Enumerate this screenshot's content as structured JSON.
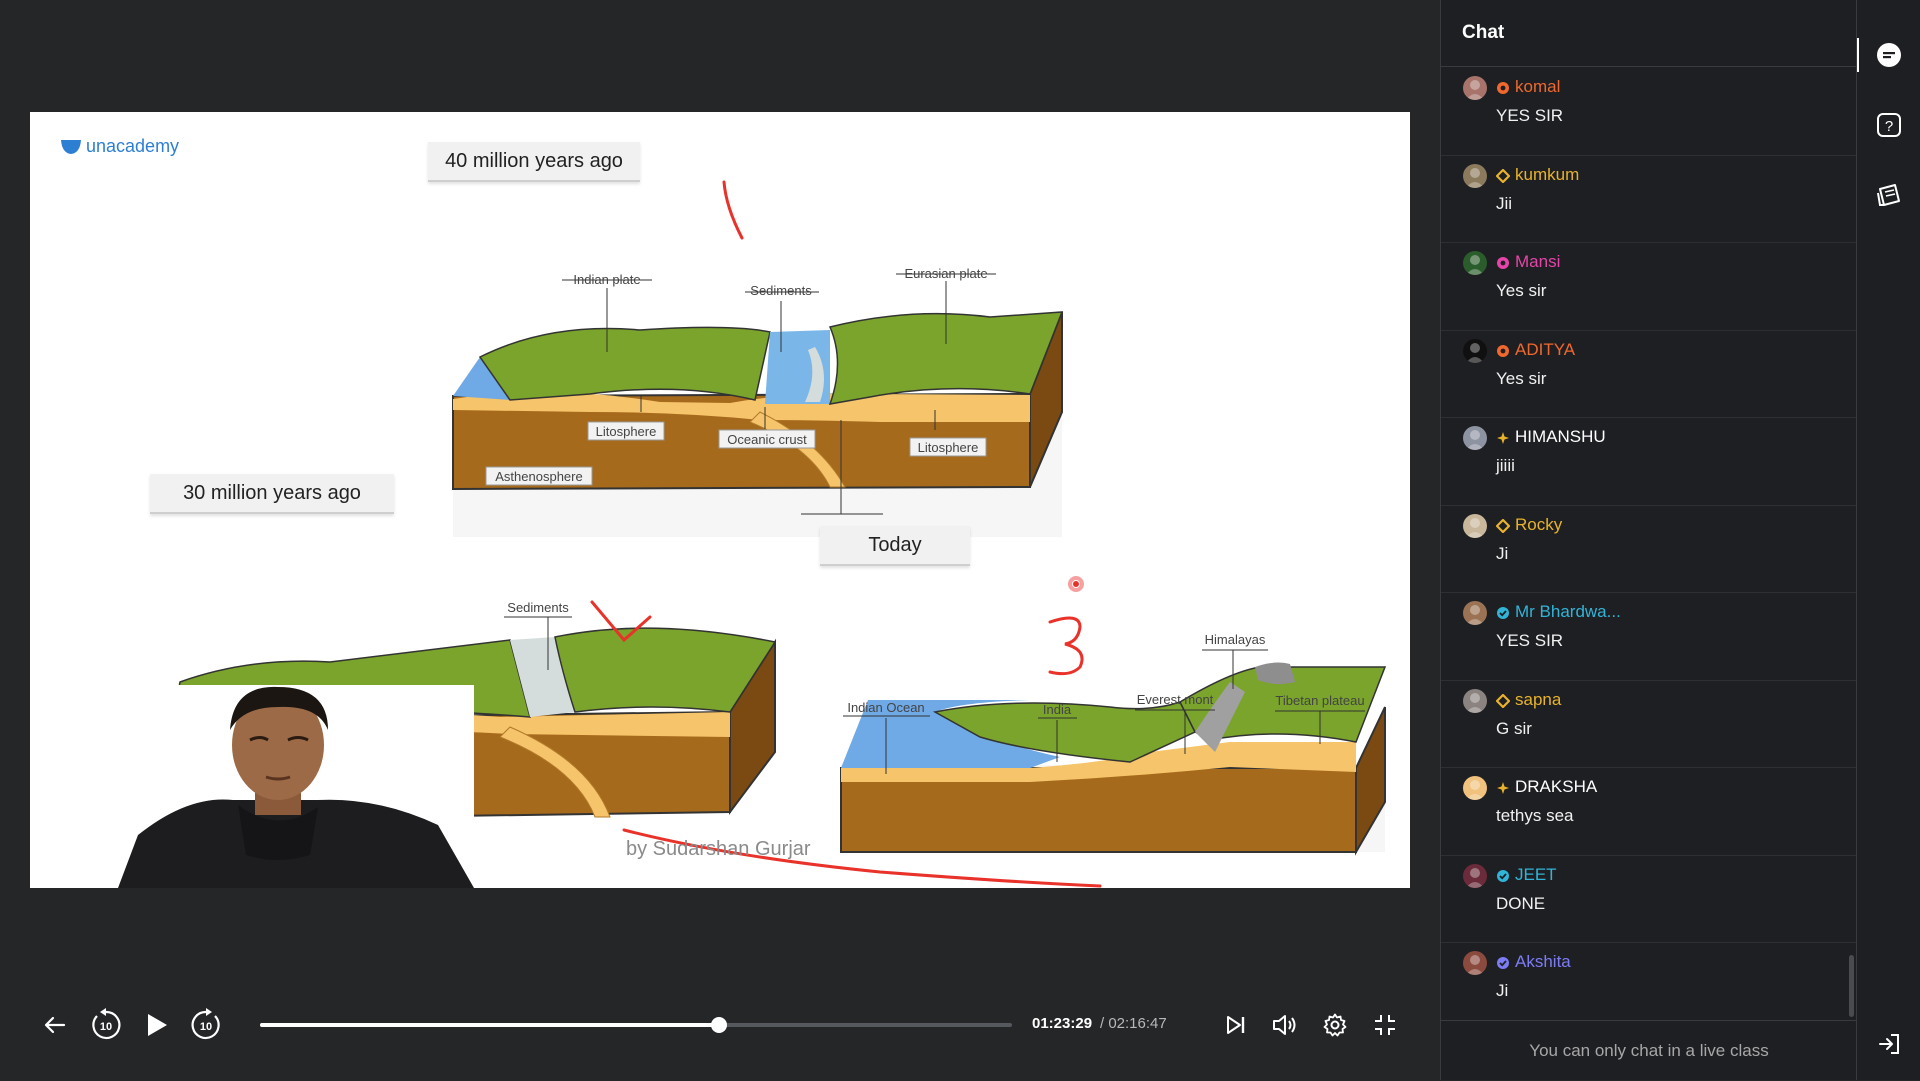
{
  "slide": {
    "brand": "unacademy",
    "era_40": "40 million years ago",
    "era_30": "30 million years ago",
    "era_today": "Today",
    "watermark": "by Sudarshan Gurjar",
    "labels_40": {
      "indian_plate": "Indian plate",
      "sediments": "Sediments",
      "eurasian_plate": "Eurasian plate",
      "litosphere_left": "Litosphere",
      "oceanic_crust": "Oceanic crust",
      "litosphere_right": "Litosphere",
      "asthenosphere": "Asthenosphere"
    },
    "labels_30": {
      "sediments": "Sediments"
    },
    "labels_today": {
      "indian_ocean": "Indian Ocean",
      "india": "India",
      "everest": "Everest mont",
      "himalayas": "Himalayas",
      "tibetan": "Tibetan plateau"
    }
  },
  "player": {
    "current_time": "01:23:29",
    "total_time": "/ 02:16:47",
    "progress": 0.6105,
    "skip_back_seconds": "10",
    "skip_forward_seconds": "10"
  },
  "chat": {
    "title": "Chat",
    "footer": "You can only chat in a live class",
    "messages": [
      {
        "name": "komal",
        "text": "YES SIR",
        "color": "#f0682d",
        "badge": "flower",
        "avatar": "#a7736a"
      },
      {
        "name": "kumkum",
        "text": "Jii",
        "color": "#e8b22b",
        "badge": "diamond",
        "avatar": "#8c7a5c"
      },
      {
        "name": "Mansi",
        "text": "Yes sir",
        "color": "#e545a8",
        "badge": "flower",
        "avatar": "#2b5d2c"
      },
      {
        "name": "ADITYA",
        "text": "Yes sir",
        "color": "#f0682d",
        "badge": "flower",
        "avatar": "#101010"
      },
      {
        "name": "HIMANSHU",
        "text": "jiiii",
        "color": "#ffffff",
        "badge": "spark",
        "avatar": "#8e93a2"
      },
      {
        "name": "Rocky",
        "text": "Ji",
        "color": "#e8b22b",
        "badge": "diamond",
        "avatar": "#c8b79a"
      },
      {
        "name": "Mr Bhardwa...",
        "text": "YES SIR",
        "color": "#31b4d8",
        "badge": "check",
        "avatar": "#9b7354"
      },
      {
        "name": "sapna",
        "text": "G sir",
        "color": "#e8b22b",
        "badge": "diamond",
        "avatar": "#8a8380"
      },
      {
        "name": "DRAKSHA",
        "text": "tethys sea",
        "color": "#ffffff",
        "badge": "spark",
        "avatar": "#f1c27d"
      },
      {
        "name": "JEET",
        "text": "DONE",
        "color": "#31b4d8",
        "badge": "check",
        "avatar": "#6b2b3a"
      },
      {
        "name": "Akshita",
        "text": "Ji",
        "color": "#7c7cf5",
        "badge": "check",
        "avatar": "#8b4a3e"
      }
    ]
  },
  "icons": {
    "back": "arrow-left-icon",
    "rewind": "rewind-10-icon",
    "play": "play-icon",
    "forward": "forward-10-icon",
    "next": "skip-next-icon",
    "volume": "volume-icon",
    "settings": "gear-icon",
    "exit_fullscreen": "exit-fullscreen-icon",
    "rail_chat": "chat-bubble-icon",
    "rail_questions": "question-icon",
    "rail_notes": "notes-icon",
    "rail_exit": "exit-icon"
  },
  "colors": {
    "background": "#252628",
    "panel": "#1e1f22",
    "accent": "#ffffff",
    "annotation_red": "#e8322a",
    "unacademy_blue": "#2d7fd3"
  }
}
